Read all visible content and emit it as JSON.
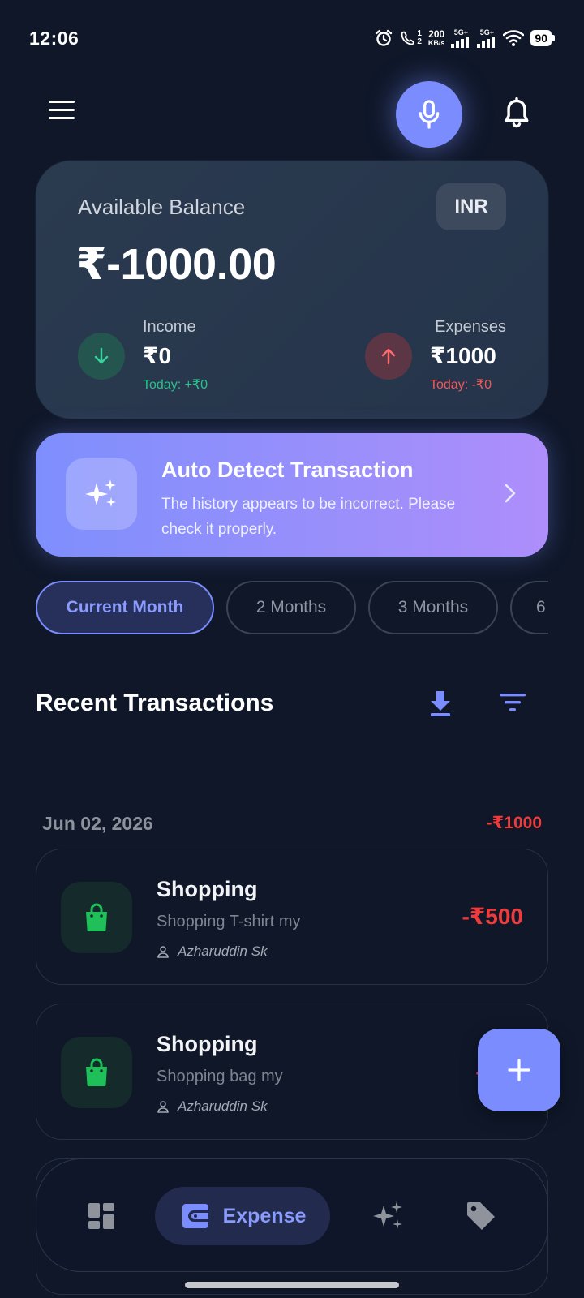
{
  "status_bar": {
    "time": "12:06",
    "call_sim_top": "1",
    "call_sim_bottom": "2",
    "net_speed_value": "200",
    "net_speed_unit": "KB/s",
    "signal_label_1": "5G+",
    "signal_label_2": "5G+",
    "battery": "90"
  },
  "header": {
    "menu_icon": "hamburger-menu-icon",
    "mic_icon": "microphone-icon",
    "bell_icon": "notification-bell-icon"
  },
  "balance": {
    "label": "Available Balance",
    "currency": "INR",
    "amount": "₹-1000.00",
    "income": {
      "title": "Income",
      "value": "₹0",
      "today": "Today: +₹0",
      "color": "#29c48c"
    },
    "expenses": {
      "title": "Expenses",
      "value": "₹1000",
      "today": "Today: -₹0",
      "color": "#ef5a5a"
    }
  },
  "auto_detect": {
    "title": "Auto Detect Transaction",
    "subtitle": "The history appears to be incorrect. Please check it properly.",
    "icon": "sparkles-icon"
  },
  "periods": [
    {
      "label": "Current Month",
      "active": true
    },
    {
      "label": "2 Months",
      "active": false
    },
    {
      "label": "3 Months",
      "active": false
    },
    {
      "label": "6",
      "active": false
    }
  ],
  "recent": {
    "title": "Recent Transactions",
    "download_icon": "download-icon",
    "filter_icon": "filter-icon"
  },
  "groups": [
    {
      "date": "Jun 02, 2026",
      "total": "-₹1000",
      "transactions": [
        {
          "title": "Shopping",
          "description": "Shopping T-shirt my",
          "user": "Azharuddin Sk",
          "amount": "-₹500",
          "icon": "shopping-bag-icon"
        },
        {
          "title": "Shopping",
          "description": "Shopping bag my",
          "user": "Azharuddin Sk",
          "amount": "-₹",
          "icon": "shopping-bag-icon"
        }
      ]
    }
  ],
  "bottom_nav": {
    "items": [
      {
        "name": "dashboard",
        "icon": "dashboard-icon"
      },
      {
        "name": "expense",
        "icon": "wallet-icon",
        "label": "Expense",
        "active": true
      },
      {
        "name": "ai",
        "icon": "sparkles-icon"
      },
      {
        "name": "tags",
        "icon": "tag-icon"
      }
    ]
  },
  "colors": {
    "background": "#0f1729",
    "accent": "#7b8cff",
    "income": "#29c48c",
    "expense": "#ee3b3b",
    "shopping_icon": "#1fbf59"
  }
}
